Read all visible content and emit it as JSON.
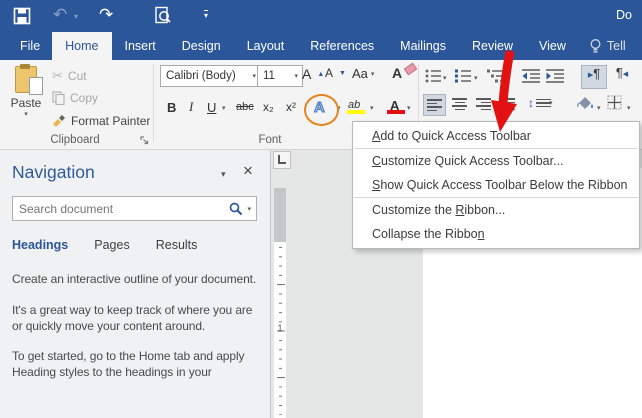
{
  "titlebar": {
    "title_fragment": "Do"
  },
  "tabs": {
    "file": "File",
    "items": [
      "Home",
      "Insert",
      "Design",
      "Layout",
      "References",
      "Mailings",
      "Review",
      "View"
    ],
    "tell": "Tell"
  },
  "ribbon": {
    "clipboard": {
      "paste": "Paste",
      "cut": "Cut",
      "copy": "Copy",
      "format_painter": "Format Painter",
      "label": "Clipboard"
    },
    "font": {
      "font_name": "Calibri (Body)",
      "font_size": "11",
      "grow": "A",
      "shrink": "A",
      "change_case": "Aa",
      "clear": "A",
      "bold": "B",
      "italic": "I",
      "underline": "U",
      "strikethrough": "abc",
      "subscript": "x₂",
      "superscript": "x²",
      "text_effects": "A",
      "highlight": "ab",
      "font_color": "A",
      "label": "Font"
    }
  },
  "menu": {
    "items": [
      {
        "pre": "",
        "key": "A",
        "post": "dd to Quick Access Toolbar"
      },
      {
        "pre": "",
        "key": "C",
        "post": "ustomize Quick Access Toolbar..."
      },
      {
        "pre": "",
        "key": "S",
        "post": "how Quick Access Toolbar Below the Ribbon"
      },
      {
        "pre": "Customize the ",
        "key": "R",
        "post": "ibbon..."
      },
      {
        "pre": "Collapse the Ribbo",
        "key": "n",
        "post": ""
      }
    ]
  },
  "nav": {
    "title": "Navigation",
    "search_placeholder": "Search document",
    "tabs": [
      "Headings",
      "Pages",
      "Results"
    ],
    "paragraphs": [
      "Create an interactive outline of your document.",
      "It's a great way to keep track of where you are or quickly move your content around.",
      "To get started, go to the Home tab and apply Heading styles to the headings in your"
    ]
  },
  "ruler": {
    "number": "1"
  },
  "colors": {
    "accent_blue": "#2b579a",
    "ribbon_bg": "#f4f4f5",
    "doc_bg": "#e5e6e6",
    "arrow_red": "#e31212",
    "circle_orange": "#e8831d",
    "highlight_yellow": "#ffff00",
    "font_color_red": "#e01010",
    "menu_text": "#3c3c3c"
  }
}
